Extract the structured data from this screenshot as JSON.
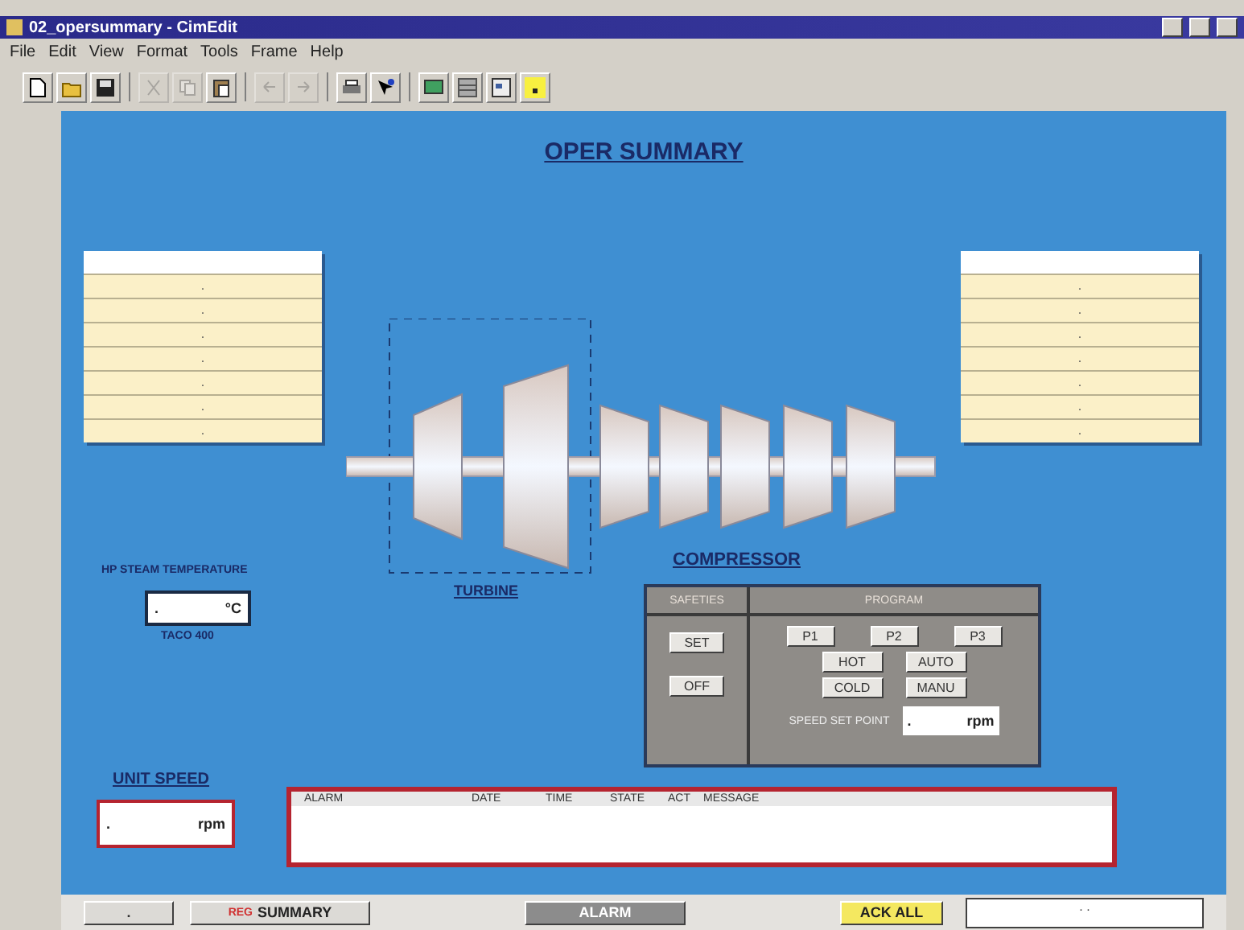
{
  "window": {
    "title": "02_opersummary - CimEdit"
  },
  "menu": [
    "File",
    "Edit",
    "View",
    "Format",
    "Tools",
    "Frame",
    "Help"
  ],
  "toolbar": [
    {
      "kind": "new"
    },
    {
      "kind": "open"
    },
    {
      "kind": "save"
    },
    {
      "kind": "sep"
    },
    {
      "kind": "cut",
      "disabled": true
    },
    {
      "kind": "copy",
      "disabled": true
    },
    {
      "kind": "paste",
      "disabled": false
    },
    {
      "kind": "sep"
    },
    {
      "kind": "undo",
      "disabled": true
    },
    {
      "kind": "redo",
      "disabled": true
    },
    {
      "kind": "sep"
    },
    {
      "kind": "print"
    },
    {
      "kind": "help"
    },
    {
      "kind": "sep"
    },
    {
      "kind": "screen"
    },
    {
      "kind": "grid"
    },
    {
      "kind": "layout"
    },
    {
      "kind": "color"
    }
  ],
  "screen": {
    "title": "OPER SUMMARY",
    "left_table": {
      "rows": [
        ".",
        ".",
        ".",
        ".",
        ".",
        ".",
        "."
      ]
    },
    "right_table": {
      "rows": [
        ".",
        ".",
        ".",
        ".",
        ".",
        ".",
        "."
      ]
    },
    "turbine_label": "TURBINE",
    "compressor_label": "COMPRESSOR",
    "temperature": {
      "label": "HP STEAM TEMPERATURE",
      "value": ".",
      "unit": "°C",
      "note": "TACO 400"
    },
    "compressor_panel": {
      "safeties_header": "SAFETIES",
      "program_header": "PROGRAM",
      "safeties": [
        "SET",
        "OFF"
      ],
      "programs": [
        "P1",
        "P2",
        "P3"
      ],
      "modes": [
        "HOT",
        "AUTO",
        "COLD",
        "MANU"
      ],
      "set_point_label": "SPEED SET POINT",
      "set_point_value": ".",
      "set_point_unit": "rpm"
    },
    "unit_speed": {
      "label": "UNIT SPEED",
      "value": ".",
      "unit": "rpm"
    },
    "alarm_table": {
      "columns": [
        "ALARM",
        "DATE",
        "TIME",
        "STATE",
        "ACT",
        "MESSAGE"
      ]
    }
  },
  "bottom_bar": {
    "left_button": ".",
    "summary_prefix": "REG",
    "summary": "SUMMARY",
    "alarm": {
      "label": "ALARM",
      "disabled": true
    },
    "ack_all": "ACK ALL",
    "field": ". ."
  }
}
